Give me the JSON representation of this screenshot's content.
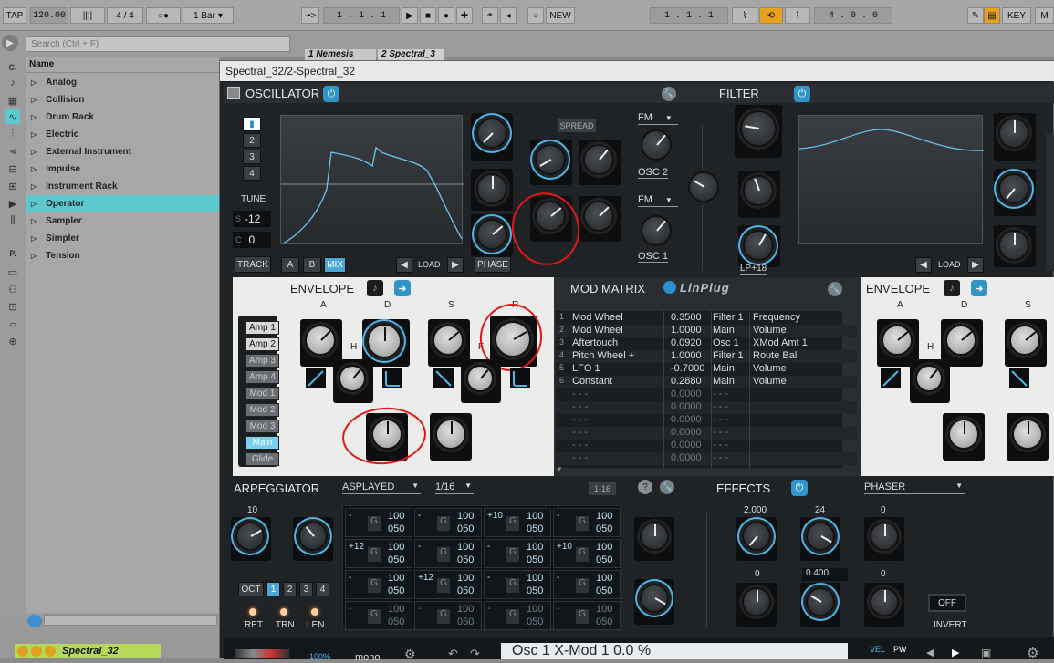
{
  "topbar": {
    "tap": "TAP",
    "tempo": "120.00",
    "meter_icon": "||||",
    "signature": "4 / 4",
    "record_icon": "○●",
    "quantize": "1 Bar",
    "follow": "-•>",
    "position": "1 .  1 .  1",
    "loop_start": "1 .  1 .  1",
    "loop_len": "4 .  0 .  0",
    "new_label": "NEW",
    "key_label": "KEY",
    "end_label": "M"
  },
  "browser": {
    "search_placeholder": "Search (Ctrl + F)",
    "column_name": "Name",
    "categories_label": "C.",
    "places_label": "P.",
    "items": [
      "Analog",
      "Collision",
      "Drum Rack",
      "Electric",
      "External Instrument",
      "Impulse",
      "Instrument Rack",
      "Operator",
      "Sampler",
      "Simpler",
      "Tension"
    ],
    "selected": "Operator"
  },
  "session": {
    "tab1": "1 Nemesis",
    "tab2": "2 Spectral_3"
  },
  "plugin": {
    "title": "Spectral_32/2-Spectral_32",
    "oscillator": {
      "title": "OSCILLATOR",
      "osc_numbers": [
        "▮",
        "2",
        "3",
        "4"
      ],
      "tune_label": "TUNE",
      "semi_label": "S",
      "semi_value": "-12",
      "cent_label": "C",
      "cent_value": "0",
      "track": "TRACK",
      "a": "A",
      "b": "B",
      "mix": "MIX",
      "load": "LOAD",
      "phase": "PHASE",
      "spread": "SPREAD",
      "fm1": "FM",
      "fm2": "FM",
      "osc2": "OSC 2",
      "osc1": "OSC 1"
    },
    "filter": {
      "title": "FILTER",
      "load": "LOAD",
      "type": "LP+18"
    },
    "envelope_left": {
      "title": "ENVELOPE",
      "labels": [
        "A",
        "D",
        "S",
        "R",
        "H",
        "F"
      ],
      "targets": [
        "Amp 1",
        "Amp 2",
        "Amp 3",
        "Amp 4",
        "Mod 1",
        "Mod 2",
        "Mod 3",
        "Main",
        "Glide"
      ],
      "active": "Main"
    },
    "mod_matrix": {
      "title": "MOD MATRIX",
      "brand": "LinPlug",
      "rows": [
        {
          "n": "1",
          "src": "Mod Wheel",
          "amt": "0.3500",
          "dst": "Filter 1",
          "param": "Frequency"
        },
        {
          "n": "2",
          "src": "Mod Wheel",
          "amt": "1.0000",
          "dst": "Main",
          "param": "Volume"
        },
        {
          "n": "3",
          "src": "Aftertouch",
          "amt": "0.0920",
          "dst": "Osc 1",
          "param": "XMod Amt 1"
        },
        {
          "n": "4",
          "src": "Pitch Wheel +",
          "amt": "1.0000",
          "dst": "Filter 1",
          "param": "Route Bal"
        },
        {
          "n": "5",
          "src": "LFO 1",
          "amt": "-0.7000",
          "dst": "Main",
          "param": "Volume"
        },
        {
          "n": "6",
          "src": "Constant",
          "amt": "0.2880",
          "dst": "Main",
          "param": "Volume"
        },
        {
          "n": "",
          "src": "- - -",
          "amt": "0.0000",
          "dst": "- - -",
          "param": ""
        },
        {
          "n": "",
          "src": "- - -",
          "amt": "0.0000",
          "dst": "- - -",
          "param": ""
        },
        {
          "n": "",
          "src": "- - -",
          "amt": "0.0000",
          "dst": "- - -",
          "param": ""
        },
        {
          "n": "",
          "src": "- - -",
          "amt": "0.0000",
          "dst": "- - -",
          "param": ""
        },
        {
          "n": "",
          "src": "- - -",
          "amt": "0.0000",
          "dst": "- - -",
          "param": ""
        },
        {
          "n": "",
          "src": "- - -",
          "amt": "0.0000",
          "dst": "- - -",
          "param": ""
        }
      ]
    },
    "envelope_right": {
      "title": "ENVELOPE",
      "labels": [
        "A",
        "D",
        "S",
        "H"
      ]
    },
    "arpeggiator": {
      "title": "ARPEGGIATOR",
      "mode": "ASPLAYED",
      "rate": "1/16",
      "range": "1-16",
      "knob_value": "10",
      "oct": "OCT",
      "oct_values": [
        "1",
        "2",
        "3",
        "4"
      ],
      "ret": "RET",
      "trn": "TRN",
      "len": "LEN",
      "steps": [
        {
          "t": "-",
          "g": "G",
          "v": "100",
          "l": "050"
        },
        {
          "t": "-",
          "g": "G",
          "v": "100",
          "l": "050"
        },
        {
          "t": "+10",
          "g": "G",
          "v": "100",
          "l": "050"
        },
        {
          "t": "-",
          "g": "G",
          "v": "100",
          "l": "050"
        },
        {
          "t": "+12",
          "g": "G",
          "v": "100",
          "l": "050"
        },
        {
          "t": "-",
          "g": "G",
          "v": "100",
          "l": "050"
        },
        {
          "t": "-",
          "g": "G",
          "v": "100",
          "l": "050"
        },
        {
          "t": "+10",
          "g": "G",
          "v": "100",
          "l": "050"
        },
        {
          "t": "-",
          "g": "G",
          "v": "100",
          "l": "050"
        },
        {
          "t": "+12",
          "g": "G",
          "v": "100",
          "l": "050"
        },
        {
          "t": "-",
          "g": "G",
          "v": "100",
          "l": "050"
        },
        {
          "t": "-",
          "g": "G",
          "v": "100",
          "l": "050"
        },
        {
          "t": "-",
          "g": "G",
          "v": "100",
          "l": "050"
        },
        {
          "t": "-",
          "g": "G",
          "v": "100",
          "l": "050"
        },
        {
          "t": "-",
          "g": "G",
          "v": "100",
          "l": "050"
        },
        {
          "t": "-",
          "g": "G",
          "v": "100",
          "l": "050"
        }
      ]
    },
    "effects": {
      "title": "EFFECTS",
      "type": "PHASER",
      "v1": "2.000",
      "v2": "24",
      "v3": "0",
      "v4": "0",
      "v5": "0.400",
      "v6": "0",
      "off": "OFF",
      "invert": "INVERT"
    },
    "bottom": {
      "percent": "100%",
      "mode": "mono",
      "display": "Osc 1 X-Mod 1 0.0 %",
      "vel": "VEL",
      "pw": "PW"
    }
  },
  "statusbar": {
    "track_name": "Spectral_32"
  },
  "colors": {
    "accent": "#4fb6e8",
    "selection": "#5cc9ce",
    "annotation": "#e01818"
  }
}
